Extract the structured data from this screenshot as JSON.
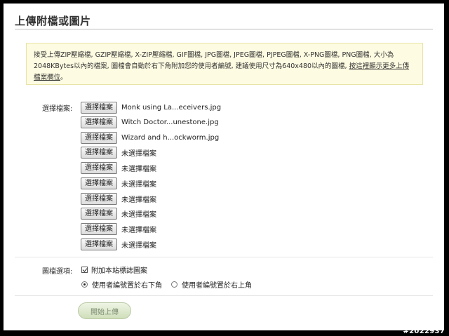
{
  "header": {
    "title": "上傳附檔或圖片"
  },
  "notice": {
    "text": "接受上傳ZIP壓縮檔, GZIP壓縮檔, X-ZIP壓縮檔, GIF圖檔, JPG圖檔, JPEG圖檔, PJPEG圖檔, X-PNG圖檔, PNG圖檔, 大小為2048KBytes以內的檔案, 圖檔會自動於右下角附加您的使用者編號, 建議使用尺寸為640x480以內的圖檔, ",
    "link": "按這裡顯示更多上傳檔案欄位",
    "end": "。"
  },
  "files": {
    "label": "選擇檔案:",
    "button_label": "選擇檔案",
    "rows": [
      "Monk using La...eceivers.jpg",
      "Witch Doctor...unestone.jpg",
      "Wizard and h...ockworm.jpg",
      "未選擇檔案",
      "未選擇檔案",
      "未選擇檔案",
      "未選擇檔案",
      "未選擇檔案",
      "未選擇檔案",
      "未選擇檔案"
    ]
  },
  "image_options": {
    "label": "圖檔選項:",
    "watermark_checkbox": "附加本站標誌圖案",
    "watermark_checked": true,
    "radio_bottom_right": "使用者編號置於右下角",
    "radio_top_right": "使用者編號置於右上角",
    "selected": "bottom-right"
  },
  "submit_label": "開始上傳",
  "image_watermark": "#2022937"
}
